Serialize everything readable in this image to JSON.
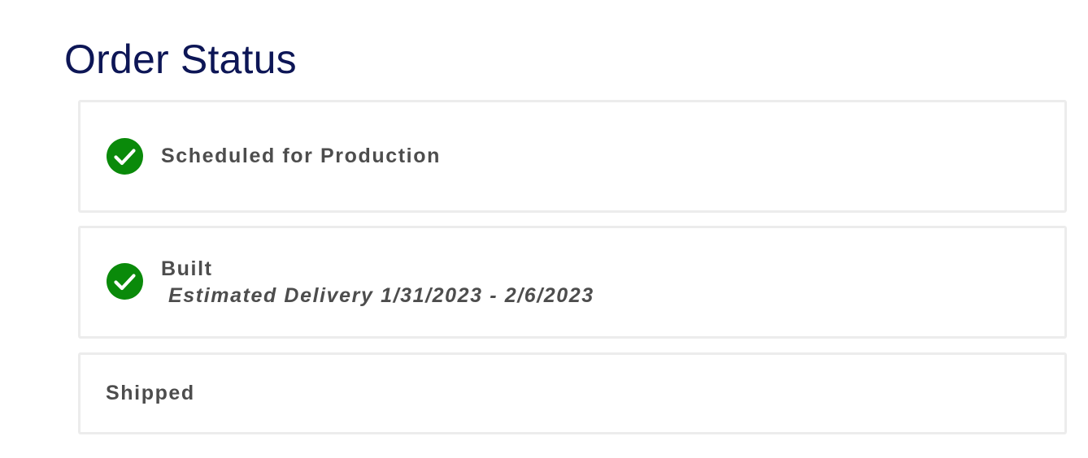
{
  "page": {
    "title": "Order Status"
  },
  "colors": {
    "title": "#0d1656",
    "check_green": "#0a8a0a",
    "text": "#4d4d4d",
    "card_border": "#ececec"
  },
  "steps": [
    {
      "label": "Scheduled for Production",
      "completed": true,
      "icon": "check-circle-icon"
    },
    {
      "label": "Built",
      "sublabel": "Estimated Delivery 1/31/2023 - 2/6/2023",
      "completed": true,
      "icon": "check-circle-icon"
    },
    {
      "label": "Shipped",
      "completed": false
    }
  ]
}
